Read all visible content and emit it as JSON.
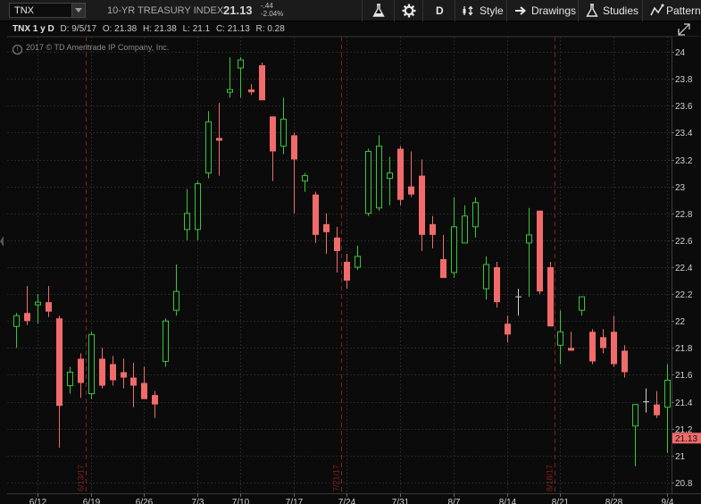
{
  "toolbar": {
    "symbol": "TNX",
    "index_name": "10-YR TREASURY INDEX",
    "last_price": "21.13",
    "change_abs": "-.44",
    "change_pct": "-2.04%",
    "timeframe": "D",
    "style_label": "Style",
    "drawings_label": "Drawings",
    "studies_label": "Studies",
    "patterns_label": "Patterns"
  },
  "chart_header": {
    "title": "TNX 1 y D",
    "date": "D: 9/5/17",
    "open": "O: 21.38",
    "high": "H: 21.38",
    "low": "L: 21.1",
    "close": "C: 21.13",
    "range": "R: 0.28"
  },
  "copyright": "2017 © TD Ameritrade IP Company, Inc.",
  "colors": {
    "up": "#35c935",
    "down": "#f26b6b",
    "neutral": "#cfcfcf",
    "price_tag": "#f26b6b",
    "event_line": "#8b1f1f"
  },
  "chart_data": {
    "type": "candlestick",
    "ylim": [
      20.8,
      24.0
    ],
    "y_ticks": [
      "24",
      "23.8",
      "23.6",
      "23.4",
      "23.2",
      "23",
      "22.8",
      "22.6",
      "22.4",
      "22.2",
      "22",
      "21.8",
      "21.6",
      "21.4",
      "21.2",
      "21",
      "20.8"
    ],
    "x_tick_labels": [
      {
        "label": "6/12",
        "index": 2
      },
      {
        "label": "6/19",
        "index": 7
      },
      {
        "label": "6/26",
        "index": 12
      },
      {
        "label": "7/3",
        "index": 17
      },
      {
        "label": "7/10",
        "index": 21
      },
      {
        "label": "7/17",
        "index": 26
      },
      {
        "label": "7/24",
        "index": 31
      },
      {
        "label": "7/31",
        "index": 36
      },
      {
        "label": "8/7",
        "index": 41
      },
      {
        "label": "8/14",
        "index": 46
      },
      {
        "label": "8/21",
        "index": 51
      },
      {
        "label": "8/28",
        "index": 56
      },
      {
        "label": "9/4",
        "index": 61
      }
    ],
    "events": [
      {
        "label": "6/13/17",
        "index": 6.5
      },
      {
        "label": "7/21/17",
        "index": 30.5
      },
      {
        "label": "8/18/17",
        "index": 50.5
      }
    ],
    "last_price": "21.13",
    "candles": [
      {
        "o": 21.96,
        "h": 22.06,
        "l": 21.8,
        "c": 22.04
      },
      {
        "o": 22.06,
        "h": 22.26,
        "l": 21.97,
        "c": 22.0
      },
      {
        "o": 22.12,
        "h": 22.2,
        "l": 21.98,
        "c": 22.14
      },
      {
        "o": 22.14,
        "h": 22.26,
        "l": 22.03,
        "c": 22.07
      },
      {
        "o": 22.02,
        "h": 22.04,
        "l": 21.06,
        "c": 21.37
      },
      {
        "o": 21.52,
        "h": 21.66,
        "l": 21.46,
        "c": 21.62
      },
      {
        "o": 21.72,
        "h": 21.76,
        "l": 21.43,
        "c": 21.54
      },
      {
        "o": 21.46,
        "h": 21.92,
        "l": 21.42,
        "c": 21.9
      },
      {
        "o": 21.72,
        "h": 21.8,
        "l": 21.5,
        "c": 21.52
      },
      {
        "o": 21.68,
        "h": 21.74,
        "l": 21.52,
        "c": 21.56
      },
      {
        "o": 21.62,
        "h": 21.72,
        "l": 21.5,
        "c": 21.58
      },
      {
        "o": 21.58,
        "h": 21.69,
        "l": 21.36,
        "c": 21.52
      },
      {
        "o": 21.54,
        "h": 21.66,
        "l": 21.44,
        "c": 21.42
      },
      {
        "o": 21.45,
        "h": 21.48,
        "l": 21.28,
        "c": 21.38
      },
      {
        "o": 21.7,
        "h": 22.02,
        "l": 21.66,
        "c": 22.0
      },
      {
        "o": 22.08,
        "h": 22.42,
        "l": 22.04,
        "c": 22.22
      },
      {
        "o": 22.68,
        "h": 22.98,
        "l": 22.6,
        "c": 22.8
      },
      {
        "o": 22.68,
        "h": 23.04,
        "l": 22.6,
        "c": 23.02
      },
      {
        "o": 23.1,
        "h": 23.56,
        "l": 23.06,
        "c": 23.48
      },
      {
        "o": 23.36,
        "h": 23.62,
        "l": 23.08,
        "c": 23.34
      },
      {
        "o": 23.7,
        "h": 23.96,
        "l": 23.66,
        "c": 23.72
      },
      {
        "o": 23.88,
        "h": 23.96,
        "l": 23.66,
        "c": 23.94
      },
      {
        "o": 23.72,
        "h": 23.76,
        "l": 23.68,
        "c": 23.7
      },
      {
        "o": 23.9,
        "h": 23.92,
        "l": 23.68,
        "c": 23.64
      },
      {
        "o": 23.52,
        "h": 23.52,
        "l": 23.04,
        "c": 23.26
      },
      {
        "o": 23.3,
        "h": 23.66,
        "l": 23.24,
        "c": 23.5
      },
      {
        "o": 23.38,
        "h": 23.4,
        "l": 22.8,
        "c": 23.2
      },
      {
        "o": 23.04,
        "h": 23.1,
        "l": 22.96,
        "c": 23.08
      },
      {
        "o": 22.94,
        "h": 22.96,
        "l": 22.58,
        "c": 22.64
      },
      {
        "o": 22.72,
        "h": 22.8,
        "l": 22.5,
        "c": 22.66
      },
      {
        "o": 22.62,
        "h": 22.7,
        "l": 22.36,
        "c": 22.52
      },
      {
        "o": 22.44,
        "h": 22.5,
        "l": 22.24,
        "c": 22.3
      },
      {
        "o": 22.4,
        "h": 22.56,
        "l": 22.38,
        "c": 22.48
      },
      {
        "o": 22.8,
        "h": 23.28,
        "l": 22.78,
        "c": 23.26
      },
      {
        "o": 22.84,
        "h": 23.38,
        "l": 22.82,
        "c": 23.3
      },
      {
        "o": 23.06,
        "h": 23.22,
        "l": 22.86,
        "c": 23.1
      },
      {
        "o": 23.28,
        "h": 23.3,
        "l": 22.86,
        "c": 22.9
      },
      {
        "o": 23.0,
        "h": 23.26,
        "l": 22.92,
        "c": 22.94
      },
      {
        "o": 23.08,
        "h": 23.2,
        "l": 22.52,
        "c": 22.64
      },
      {
        "o": 22.72,
        "h": 22.78,
        "l": 22.54,
        "c": 22.64
      },
      {
        "o": 22.46,
        "h": 22.64,
        "l": 22.36,
        "c": 22.32
      },
      {
        "o": 22.36,
        "h": 22.92,
        "l": 22.32,
        "c": 22.7
      },
      {
        "o": 22.58,
        "h": 22.86,
        "l": 22.58,
        "c": 22.78
      },
      {
        "o": 22.7,
        "h": 22.92,
        "l": 22.62,
        "c": 22.88
      },
      {
        "o": 22.24,
        "h": 22.48,
        "l": 22.16,
        "c": 22.42
      },
      {
        "o": 22.4,
        "h": 22.44,
        "l": 22.1,
        "c": 22.14
      },
      {
        "o": 21.98,
        "h": 22.04,
        "l": 21.84,
        "c": 21.9
      },
      {
        "o": 22.18,
        "h": 22.24,
        "l": 22.04,
        "c": 22.18
      },
      {
        "o": 22.58,
        "h": 22.84,
        "l": 22.18,
        "c": 22.64
      },
      {
        "o": 22.82,
        "h": 22.82,
        "l": 22.2,
        "c": 22.22
      },
      {
        "o": 22.4,
        "h": 22.44,
        "l": 21.96,
        "c": 21.96
      },
      {
        "o": 21.82,
        "h": 22.08,
        "l": 21.68,
        "c": 21.92
      },
      {
        "o": 21.8,
        "h": 21.92,
        "l": 21.78,
        "c": 21.78
      },
      {
        "o": 22.08,
        "h": 22.18,
        "l": 22.04,
        "c": 22.18
      },
      {
        "o": 21.92,
        "h": 21.94,
        "l": 21.68,
        "c": 21.7
      },
      {
        "o": 21.88,
        "h": 21.94,
        "l": 21.76,
        "c": 21.8
      },
      {
        "o": 21.92,
        "h": 22.04,
        "l": 21.66,
        "c": 21.68
      },
      {
        "o": 21.78,
        "h": 21.82,
        "l": 21.58,
        "c": 21.62
      },
      {
        "o": 21.22,
        "h": 21.38,
        "l": 20.92,
        "c": 21.38
      },
      {
        "o": 21.4,
        "h": 21.5,
        "l": 21.32,
        "c": 21.4
      },
      {
        "o": 21.38,
        "h": 21.48,
        "l": 21.28,
        "c": 21.3
      },
      {
        "o": 21.36,
        "h": 21.68,
        "l": 21.02,
        "c": 21.56
      },
      {
        "o": 21.38,
        "h": 21.38,
        "l": 21.1,
        "c": 21.13
      }
    ]
  }
}
